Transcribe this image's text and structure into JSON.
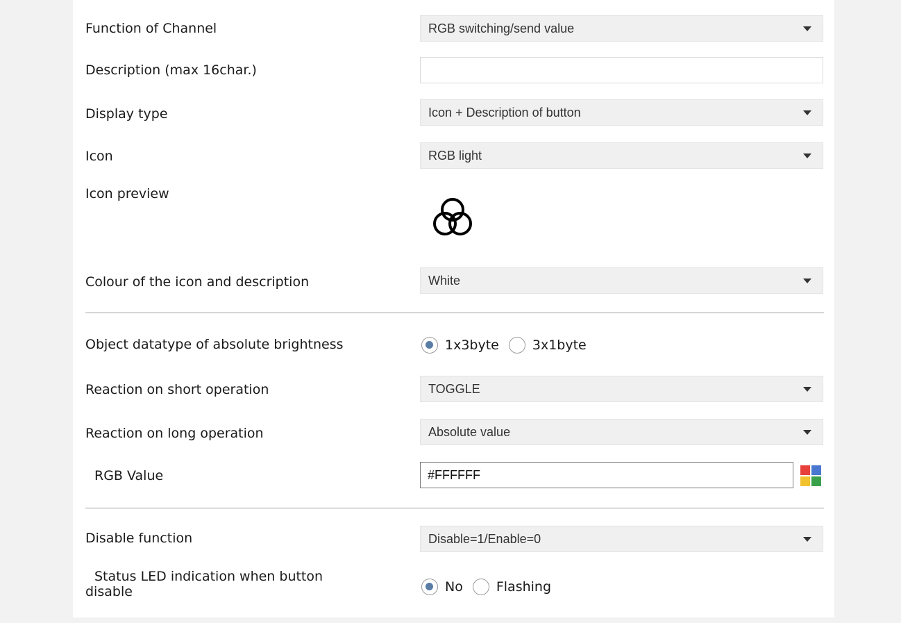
{
  "form": {
    "function_of_channel": {
      "label": "Function of Channel",
      "value": "RGB switching/send value"
    },
    "description": {
      "label": "Description (max 16char.)",
      "value": ""
    },
    "display_type": {
      "label": "Display type",
      "value": "Icon + Description of button"
    },
    "icon": {
      "label": "Icon",
      "value": "RGB light"
    },
    "icon_preview": {
      "label": "Icon preview",
      "icon": "rgb-light-icon"
    },
    "colour": {
      "label": "Colour of the icon and description",
      "value": "White"
    },
    "object_datatype": {
      "label": "Object datatype of absolute brightness",
      "options": [
        "1x3byte",
        "3x1byte"
      ],
      "selected": "1x3byte"
    },
    "reaction_short": {
      "label": "Reaction on short operation",
      "value": "TOGGLE"
    },
    "reaction_long": {
      "label": "Reaction on long operation",
      "value": "Absolute value"
    },
    "rgb_value": {
      "label": "RGB Value",
      "value": "#FFFFFF",
      "picker_icon": "color-palette-icon"
    },
    "disable_function": {
      "label": "Disable function",
      "value": "Disable=1/Enable=0"
    },
    "status_led": {
      "label_line1": "Status LED indication when button",
      "label_line2": "disable",
      "options": [
        "No",
        "Flashing"
      ],
      "selected": "No"
    }
  },
  "colors": {
    "panel_background": "#ffffff",
    "page_background": "#f2f2f2",
    "dropdown_background": "#f0f0f0",
    "radio_selected": "#5a7da6",
    "palette": [
      "#e8413c",
      "#4a78d0",
      "#f2c12e",
      "#3aa14a"
    ]
  }
}
